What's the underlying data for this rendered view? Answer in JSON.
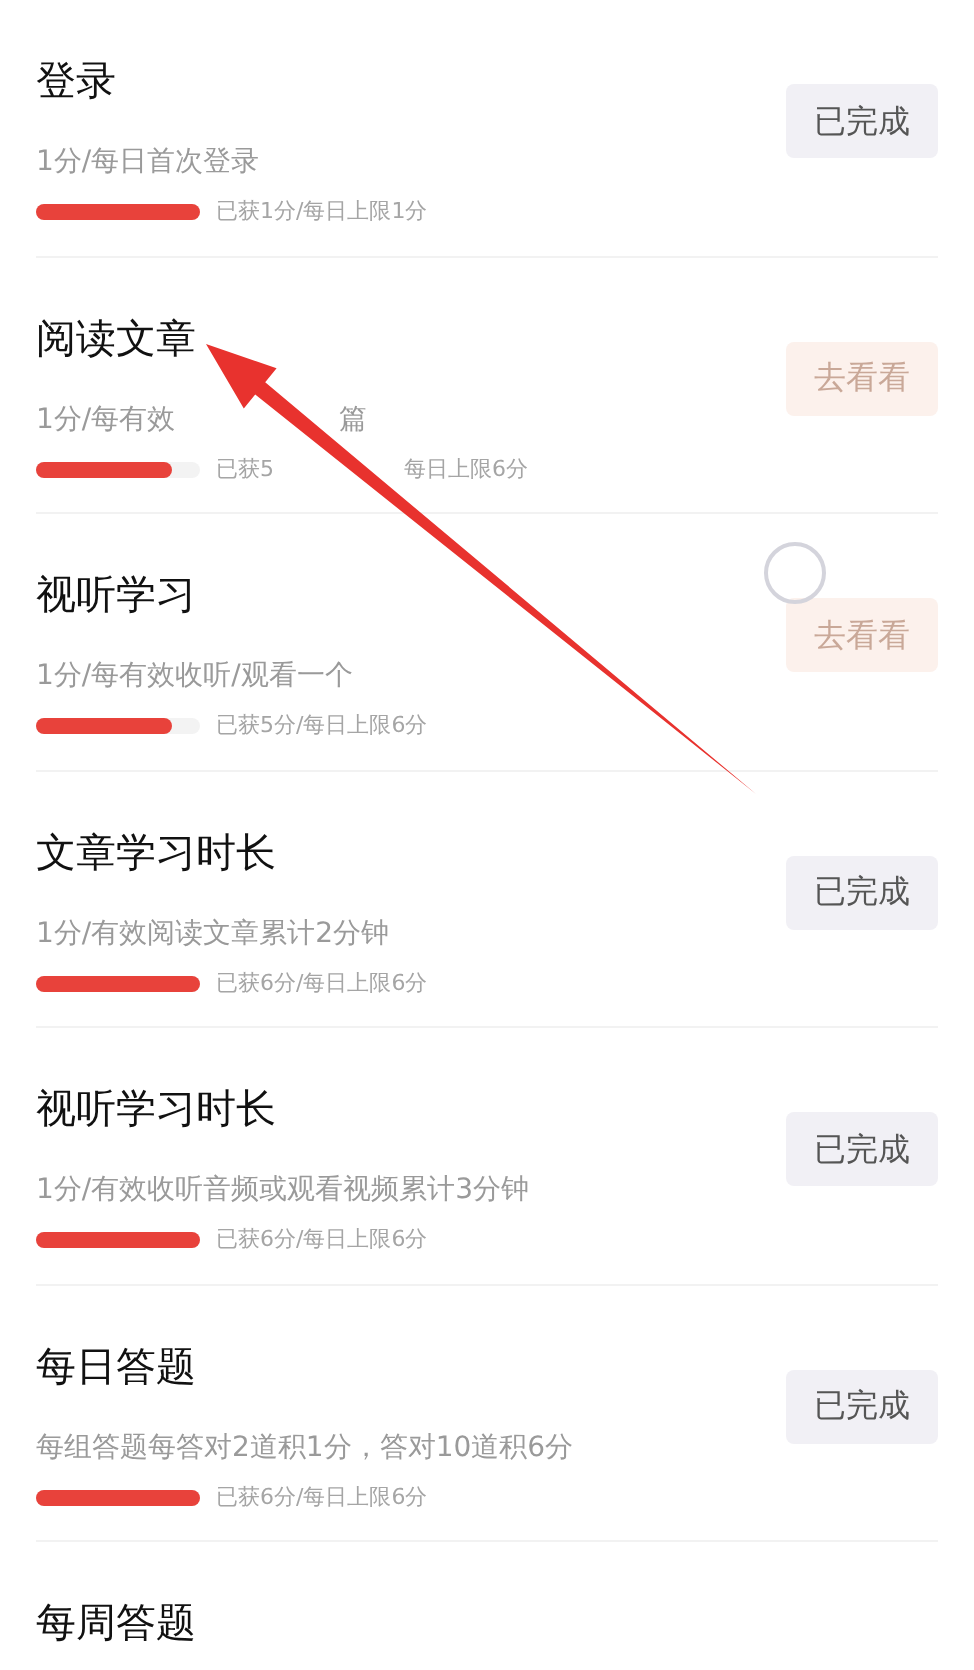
{
  "tasks": [
    {
      "title": "登录",
      "description": [
        "1分/每日首次登录"
      ],
      "level": 1,
      "progress_text": [
        "已获1分/每日上限1分"
      ],
      "button": {
        "label": "已完成",
        "completed": true
      }
    },
    {
      "title": "阅读文章",
      "description": [
        "1分/每有效",
        "篇"
      ],
      "level": 0.83,
      "progress_text": [
        "已获5",
        "每日上限6分"
      ],
      "button": {
        "label": "去看看",
        "completed": false
      }
    },
    {
      "title": "视听学习",
      "description": [
        "1分/每有效收听/观看一个"
      ],
      "level": 0.83,
      "progress_text": [
        "已获5分/每日上限6分"
      ],
      "button": {
        "label": "去看看",
        "completed": false
      }
    },
    {
      "title": "文章学习时长",
      "description": [
        "1分/有效阅读文章累计2分钟"
      ],
      "level": 1,
      "progress_text": [
        "已获6分/每日上限6分"
      ],
      "button": {
        "label": "已完成",
        "completed": true
      }
    },
    {
      "title": "视听学习时长",
      "description": [
        "1分/有效收听音频或观看视频累计3分钟"
      ],
      "level": 1,
      "progress_text": [
        "已获6分/每日上限6分"
      ],
      "button": {
        "label": "已完成",
        "completed": true
      }
    },
    {
      "title": "每日答题",
      "description": [
        "每组答题每答对2道积1分，答对10道积6分"
      ],
      "level": 1,
      "progress_text": [
        "已获6分/每日上限6分"
      ],
      "button": {
        "label": "已完成",
        "completed": true
      }
    },
    {
      "title": "每周答题"
    }
  ]
}
